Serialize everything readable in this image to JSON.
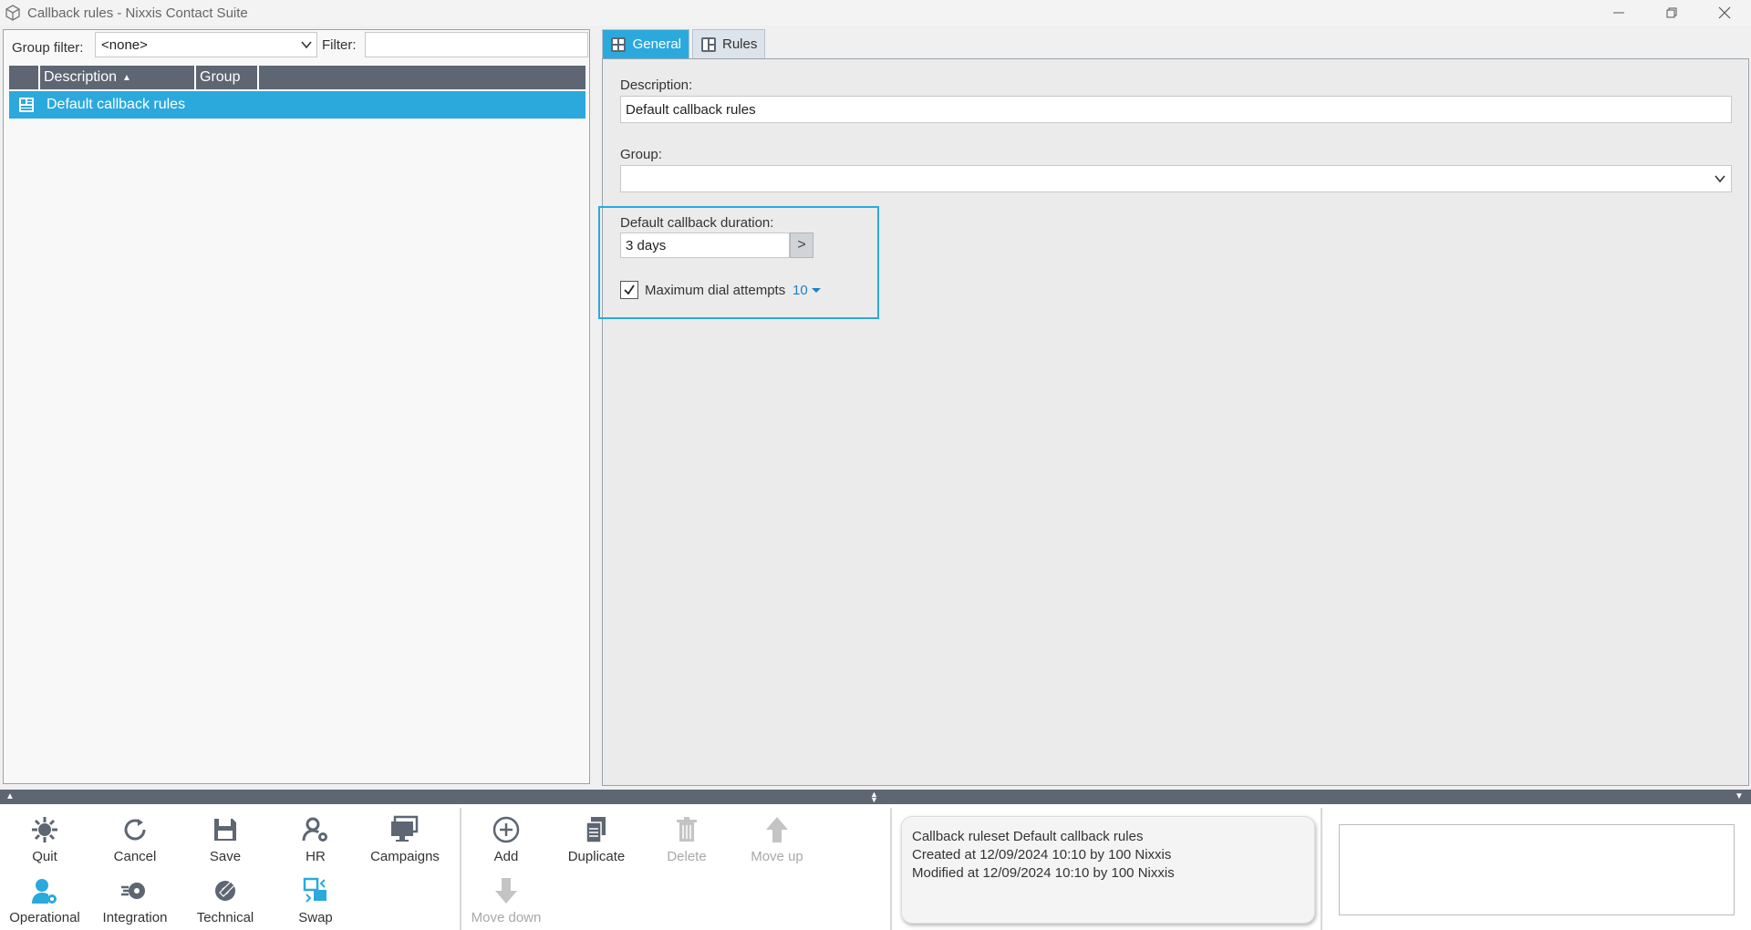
{
  "window": {
    "title": "Callback rules - Nixxis Contact Suite",
    "controls": [
      "minimize",
      "restore",
      "close"
    ]
  },
  "left": {
    "group_filter_label": "Group filter:",
    "group_filter_value": "<none>",
    "filter_label": "Filter:",
    "filter_value": "",
    "columns": [
      "",
      "Description",
      "Group",
      ""
    ],
    "sort_indicator": "▲",
    "rows": [
      {
        "description": "Default callback rules",
        "group": ""
      }
    ]
  },
  "tabs": [
    {
      "label": "General",
      "active": true
    },
    {
      "label": "Rules",
      "active": false
    }
  ],
  "general": {
    "description_label": "Description:",
    "description_value": "Default callback rules",
    "group_label": "Group:",
    "group_value": "",
    "duration_label": "Default callback duration:",
    "duration_value": "3 days",
    "duration_button": ">",
    "max_dial_checked": true,
    "max_dial_label": "Maximum dial attempts",
    "max_dial_value": "10"
  },
  "toolbar": {
    "quit": "Quit",
    "cancel": "Cancel",
    "save": "Save",
    "hr": "HR",
    "campaigns": "Campaigns",
    "operational": "Operational",
    "integration": "Integration",
    "technical": "Technical",
    "swap": "Swap",
    "add": "Add",
    "duplicate": "Duplicate",
    "delete": "Delete",
    "move_up": "Move up",
    "move_down": "Move down"
  },
  "info": {
    "line1": "Callback ruleset Default callback rules",
    "line2": "Created at 12/09/2024 10:10 by 100 Nixxis",
    "line3": "Modified at 12/09/2024 10:10 by 100 Nixxis"
  },
  "colors": {
    "accent": "#2ba9dd",
    "header": "#5d6672",
    "icon": "#5d6672",
    "icon_blue": "#2ba9dd",
    "disabled": "#a8a8a8"
  }
}
